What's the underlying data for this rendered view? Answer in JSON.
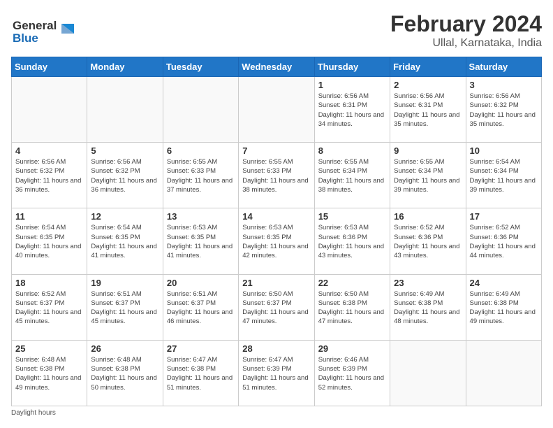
{
  "header": {
    "title": "February 2024",
    "subtitle": "Ullal, Karnataka, India"
  },
  "logo": {
    "line1": "General",
    "line2": "Blue"
  },
  "days_of_week": [
    "Sunday",
    "Monday",
    "Tuesday",
    "Wednesday",
    "Thursday",
    "Friday",
    "Saturday"
  ],
  "footer_note": "Daylight hours",
  "weeks": [
    [
      {
        "day": "",
        "info": ""
      },
      {
        "day": "",
        "info": ""
      },
      {
        "day": "",
        "info": ""
      },
      {
        "day": "",
        "info": ""
      },
      {
        "day": "1",
        "info": "Sunrise: 6:56 AM\nSunset: 6:31 PM\nDaylight: 11 hours and 34 minutes."
      },
      {
        "day": "2",
        "info": "Sunrise: 6:56 AM\nSunset: 6:31 PM\nDaylight: 11 hours and 35 minutes."
      },
      {
        "day": "3",
        "info": "Sunrise: 6:56 AM\nSunset: 6:32 PM\nDaylight: 11 hours and 35 minutes."
      }
    ],
    [
      {
        "day": "4",
        "info": "Sunrise: 6:56 AM\nSunset: 6:32 PM\nDaylight: 11 hours and 36 minutes."
      },
      {
        "day": "5",
        "info": "Sunrise: 6:56 AM\nSunset: 6:32 PM\nDaylight: 11 hours and 36 minutes."
      },
      {
        "day": "6",
        "info": "Sunrise: 6:55 AM\nSunset: 6:33 PM\nDaylight: 11 hours and 37 minutes."
      },
      {
        "day": "7",
        "info": "Sunrise: 6:55 AM\nSunset: 6:33 PM\nDaylight: 11 hours and 38 minutes."
      },
      {
        "day": "8",
        "info": "Sunrise: 6:55 AM\nSunset: 6:34 PM\nDaylight: 11 hours and 38 minutes."
      },
      {
        "day": "9",
        "info": "Sunrise: 6:55 AM\nSunset: 6:34 PM\nDaylight: 11 hours and 39 minutes."
      },
      {
        "day": "10",
        "info": "Sunrise: 6:54 AM\nSunset: 6:34 PM\nDaylight: 11 hours and 39 minutes."
      }
    ],
    [
      {
        "day": "11",
        "info": "Sunrise: 6:54 AM\nSunset: 6:35 PM\nDaylight: 11 hours and 40 minutes."
      },
      {
        "day": "12",
        "info": "Sunrise: 6:54 AM\nSunset: 6:35 PM\nDaylight: 11 hours and 41 minutes."
      },
      {
        "day": "13",
        "info": "Sunrise: 6:53 AM\nSunset: 6:35 PM\nDaylight: 11 hours and 41 minutes."
      },
      {
        "day": "14",
        "info": "Sunrise: 6:53 AM\nSunset: 6:35 PM\nDaylight: 11 hours and 42 minutes."
      },
      {
        "day": "15",
        "info": "Sunrise: 6:53 AM\nSunset: 6:36 PM\nDaylight: 11 hours and 43 minutes."
      },
      {
        "day": "16",
        "info": "Sunrise: 6:52 AM\nSunset: 6:36 PM\nDaylight: 11 hours and 43 minutes."
      },
      {
        "day": "17",
        "info": "Sunrise: 6:52 AM\nSunset: 6:36 PM\nDaylight: 11 hours and 44 minutes."
      }
    ],
    [
      {
        "day": "18",
        "info": "Sunrise: 6:52 AM\nSunset: 6:37 PM\nDaylight: 11 hours and 45 minutes."
      },
      {
        "day": "19",
        "info": "Sunrise: 6:51 AM\nSunset: 6:37 PM\nDaylight: 11 hours and 45 minutes."
      },
      {
        "day": "20",
        "info": "Sunrise: 6:51 AM\nSunset: 6:37 PM\nDaylight: 11 hours and 46 minutes."
      },
      {
        "day": "21",
        "info": "Sunrise: 6:50 AM\nSunset: 6:37 PM\nDaylight: 11 hours and 47 minutes."
      },
      {
        "day": "22",
        "info": "Sunrise: 6:50 AM\nSunset: 6:38 PM\nDaylight: 11 hours and 47 minutes."
      },
      {
        "day": "23",
        "info": "Sunrise: 6:49 AM\nSunset: 6:38 PM\nDaylight: 11 hours and 48 minutes."
      },
      {
        "day": "24",
        "info": "Sunrise: 6:49 AM\nSunset: 6:38 PM\nDaylight: 11 hours and 49 minutes."
      }
    ],
    [
      {
        "day": "25",
        "info": "Sunrise: 6:48 AM\nSunset: 6:38 PM\nDaylight: 11 hours and 49 minutes."
      },
      {
        "day": "26",
        "info": "Sunrise: 6:48 AM\nSunset: 6:38 PM\nDaylight: 11 hours and 50 minutes."
      },
      {
        "day": "27",
        "info": "Sunrise: 6:47 AM\nSunset: 6:38 PM\nDaylight: 11 hours and 51 minutes."
      },
      {
        "day": "28",
        "info": "Sunrise: 6:47 AM\nSunset: 6:39 PM\nDaylight: 11 hours and 51 minutes."
      },
      {
        "day": "29",
        "info": "Sunrise: 6:46 AM\nSunset: 6:39 PM\nDaylight: 11 hours and 52 minutes."
      },
      {
        "day": "",
        "info": ""
      },
      {
        "day": "",
        "info": ""
      }
    ]
  ]
}
